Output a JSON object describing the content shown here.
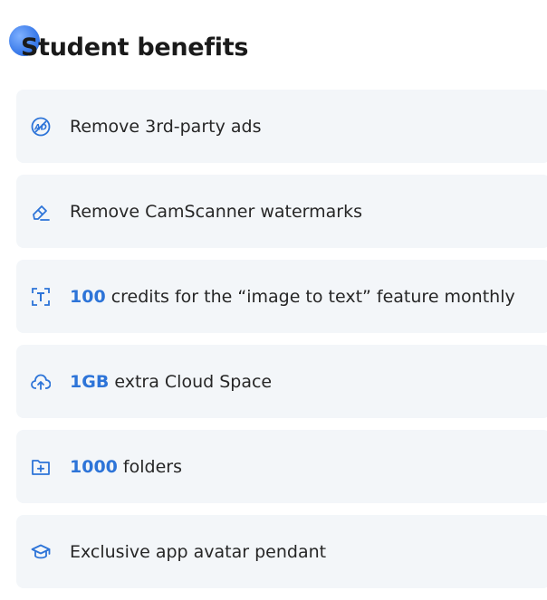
{
  "header": {
    "title": "Student benefits"
  },
  "benefits": [
    {
      "icon": "no-ads-icon",
      "highlight": "",
      "text": "Remove 3rd-party ads"
    },
    {
      "icon": "eraser-icon",
      "highlight": "",
      "text": "Remove CamScanner watermarks"
    },
    {
      "icon": "image-to-text-icon",
      "highlight": "100",
      "text": " credits for the “image to text” feature monthly"
    },
    {
      "icon": "cloud-upload-icon",
      "highlight": "1GB",
      "text": " extra Cloud Space"
    },
    {
      "icon": "folder-add-icon",
      "highlight": "1000",
      "text": " folders"
    },
    {
      "icon": "graduation-cap-icon",
      "highlight": "",
      "text": "Exclusive app avatar pendant"
    }
  ],
  "colors": {
    "accent": "#2d74d8",
    "card_bg": "#f3f6f9",
    "text": "#262626"
  }
}
